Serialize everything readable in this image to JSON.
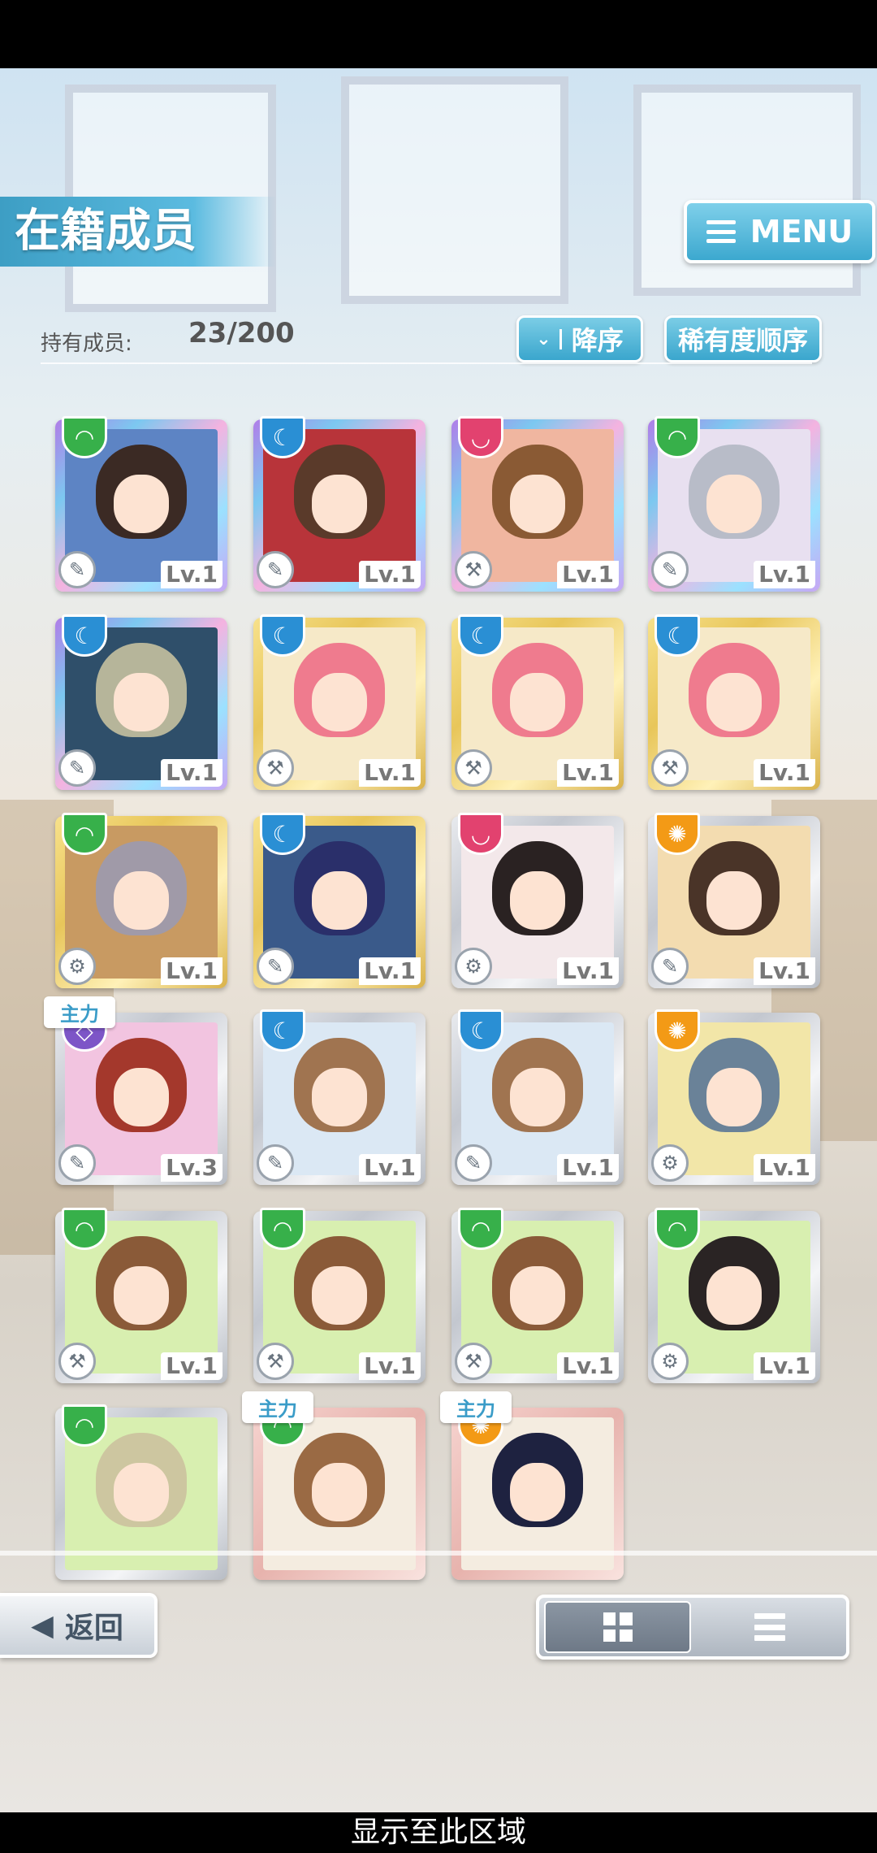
{
  "screen": {
    "title": "在籍成员",
    "menu_label": "MENU",
    "owned_label": "持有成员:",
    "owned_count": "23/200",
    "sort_order_label": "降序",
    "sort_order_icon": "⌄",
    "sort_rarity_label": "稀有度顺序",
    "back_label": "返回",
    "back_icon": "◀",
    "footer": "显示至此区域"
  },
  "cards": [
    {
      "frame": "rain",
      "attr": "green",
      "attr_icon": "◠",
      "role": "✎",
      "level": "Lv.1",
      "hair": "#3b2a24",
      "bg": "#5d84c4",
      "main": ""
    },
    {
      "frame": "rain",
      "attr": "blue",
      "attr_icon": "☾",
      "role": "✎",
      "level": "Lv.1",
      "hair": "#5a3a2a",
      "bg": "#b8343a",
      "main": ""
    },
    {
      "frame": "rain",
      "attr": "pink",
      "attr_icon": "◡",
      "role": "⚒",
      "level": "Lv.1",
      "hair": "#8a5a34",
      "bg": "#f0b6a0",
      "main": ""
    },
    {
      "frame": "rain",
      "attr": "green",
      "attr_icon": "◠",
      "role": "✎",
      "level": "Lv.1",
      "hair": "#b8bcc8",
      "bg": "#e8e0f0",
      "main": ""
    },
    {
      "frame": "rain",
      "attr": "blue",
      "attr_icon": "☾",
      "role": "✎",
      "level": "Lv.1",
      "hair": "#b6b59a",
      "bg": "#2f4f6a",
      "main": ""
    },
    {
      "frame": "gold",
      "attr": "blue",
      "attr_icon": "☾",
      "role": "⚒",
      "level": "Lv.1",
      "hair": "#ef7b8e",
      "bg": "#f6e9c8",
      "main": ""
    },
    {
      "frame": "gold",
      "attr": "blue",
      "attr_icon": "☾",
      "role": "⚒",
      "level": "Lv.1",
      "hair": "#ef7b8e",
      "bg": "#f6e9c8",
      "main": ""
    },
    {
      "frame": "gold",
      "attr": "blue",
      "attr_icon": "☾",
      "role": "⚒",
      "level": "Lv.1",
      "hair": "#ef7b8e",
      "bg": "#f6e9c8",
      "main": ""
    },
    {
      "frame": "gold",
      "attr": "green",
      "attr_icon": "◠",
      "role": "⚙",
      "level": "Lv.1",
      "hair": "#a09aa8",
      "bg": "#c89a62",
      "main": ""
    },
    {
      "frame": "gold",
      "attr": "blue",
      "attr_icon": "☾",
      "role": "✎",
      "level": "Lv.1",
      "hair": "#2a2f6a",
      "bg": "#3a5a8a",
      "main": ""
    },
    {
      "frame": "silver",
      "attr": "pink",
      "attr_icon": "◡",
      "role": "⚙",
      "level": "Lv.1",
      "hair": "#2a2222",
      "bg": "#f3e8ea",
      "main": ""
    },
    {
      "frame": "silver",
      "attr": "orange",
      "attr_icon": "✺",
      "role": "✎",
      "level": "Lv.1",
      "hair": "#4a3428",
      "bg": "#f3dcb0",
      "main": ""
    },
    {
      "frame": "silver",
      "attr": "purple",
      "attr_icon": "◇",
      "role": "✎",
      "level": "Lv.3",
      "hair": "#a4382c",
      "bg": "#f2c4e0",
      "main": "主力"
    },
    {
      "frame": "silver",
      "attr": "blue",
      "attr_icon": "☾",
      "role": "✎",
      "level": "Lv.1",
      "hair": "#a07450",
      "bg": "#dbe8f4",
      "main": ""
    },
    {
      "frame": "silver",
      "attr": "blue",
      "attr_icon": "☾",
      "role": "✎",
      "level": "Lv.1",
      "hair": "#a07450",
      "bg": "#dbe8f4",
      "main": ""
    },
    {
      "frame": "silver",
      "attr": "orange",
      "attr_icon": "✺",
      "role": "⚙",
      "level": "Lv.1",
      "hair": "#6a8298",
      "bg": "#f2e6a8",
      "main": ""
    },
    {
      "frame": "silver",
      "attr": "green",
      "attr_icon": "◠",
      "role": "⚒",
      "level": "Lv.1",
      "hair": "#8a5a38",
      "bg": "#d8efb0",
      "main": ""
    },
    {
      "frame": "silver",
      "attr": "green",
      "attr_icon": "◠",
      "role": "⚒",
      "level": "Lv.1",
      "hair": "#8a5a38",
      "bg": "#d8efb0",
      "main": ""
    },
    {
      "frame": "silver",
      "attr": "green",
      "attr_icon": "◠",
      "role": "⚒",
      "level": "Lv.1",
      "hair": "#8a5a38",
      "bg": "#d8efb0",
      "main": ""
    },
    {
      "frame": "silver",
      "attr": "green",
      "attr_icon": "◠",
      "role": "⚙",
      "level": "Lv.1",
      "hair": "#2a2424",
      "bg": "#d8efb0",
      "main": ""
    },
    {
      "frame": "silver",
      "attr": "green",
      "attr_icon": "◠",
      "role": "",
      "level": "",
      "hair": "#cdc6a0",
      "bg": "#d8efb0",
      "main": ""
    },
    {
      "frame": "rose",
      "attr": "green",
      "attr_icon": "◠",
      "role": "",
      "level": "",
      "hair": "#9a6a44",
      "bg": "#f4ece0",
      "main": "主力"
    },
    {
      "frame": "rose",
      "attr": "orange",
      "attr_icon": "✺",
      "role": "",
      "level": "",
      "hair": "#1e2240",
      "bg": "#f4ece0",
      "main": "主力"
    }
  ]
}
